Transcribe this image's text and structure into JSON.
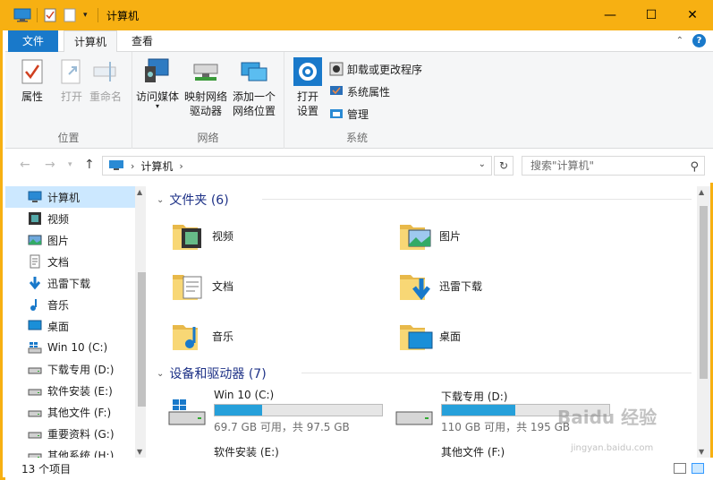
{
  "titlebar": {
    "title": "计算机",
    "minimize": "—",
    "maximize": "☐",
    "close": "✕"
  },
  "tabs": {
    "file": "文件",
    "computer": "计算机",
    "view": "查看"
  },
  "ribbon": {
    "location_group": {
      "label": "位置",
      "properties": "属性",
      "open": "打开",
      "rename": "重命名"
    },
    "network_group": {
      "label": "网络",
      "access_media": "访问媒体",
      "map_drive_line1": "映射网络",
      "map_drive_line2": "驱动器",
      "add_location_line1": "添加一个",
      "add_location_line2": "网络位置"
    },
    "system_group": {
      "label": "系统",
      "open_settings_line1": "打开",
      "open_settings_line2": "设置",
      "uninstall": "卸载或更改程序",
      "system_properties": "系统属性",
      "manage": "管理"
    }
  },
  "address": {
    "path": "计算机",
    "search_placeholder": "搜索\"计算机\""
  },
  "nav": {
    "items": [
      {
        "label": "计算机",
        "icon": "computer-icon"
      },
      {
        "label": "视频",
        "icon": "video-icon"
      },
      {
        "label": "图片",
        "icon": "pictures-icon"
      },
      {
        "label": "文档",
        "icon": "documents-icon"
      },
      {
        "label": "迅雷下载",
        "icon": "download-icon"
      },
      {
        "label": "音乐",
        "icon": "music-icon"
      },
      {
        "label": "桌面",
        "icon": "desktop-icon"
      },
      {
        "label": "Win 10 (C:)",
        "icon": "windows-drive-icon"
      },
      {
        "label": "下载专用 (D:)",
        "icon": "drive-icon"
      },
      {
        "label": "软件安装 (E:)",
        "icon": "drive-icon"
      },
      {
        "label": "其他文件 (F:)",
        "icon": "drive-icon"
      },
      {
        "label": "重要资料 (G:)",
        "icon": "drive-icon"
      },
      {
        "label": "其他系统 (H:)",
        "icon": "drive-icon"
      }
    ]
  },
  "content": {
    "folders_header": "文件夹 (6)",
    "folders": [
      {
        "label": "视频",
        "icon": "video-folder-icon"
      },
      {
        "label": "图片",
        "icon": "pictures-folder-icon"
      },
      {
        "label": "文档",
        "icon": "documents-folder-icon"
      },
      {
        "label": "迅雷下载",
        "icon": "download-folder-icon"
      },
      {
        "label": "音乐",
        "icon": "music-folder-icon"
      },
      {
        "label": "桌面",
        "icon": "desktop-folder-icon"
      }
    ],
    "drives_header": "设备和驱动器 (7)",
    "drives": [
      {
        "label": "Win 10 (C:)",
        "free": "69.7 GB 可用，共 97.5 GB",
        "used_fraction": 0.285,
        "icon": "windows-drive-icon"
      },
      {
        "label": "下载专用 (D:)",
        "free": "110 GB 可用，共 195 GB",
        "used_fraction": 0.436,
        "icon": "drive-icon"
      },
      {
        "label": "软件安装 (E:)",
        "icon": "drive-icon"
      },
      {
        "label": "其他文件 (F:)",
        "icon": "drive-icon"
      }
    ]
  },
  "status": {
    "count": "13 个项目"
  },
  "watermark": {
    "main": "Baidu 经验",
    "sub": "jingyan.baidu.com"
  },
  "colors": {
    "titlebar": "#f7b012",
    "accent": "#1979ca",
    "selected": "#cce8ff",
    "drive_fill": "#26a0da",
    "group_header": "#1e3287"
  }
}
